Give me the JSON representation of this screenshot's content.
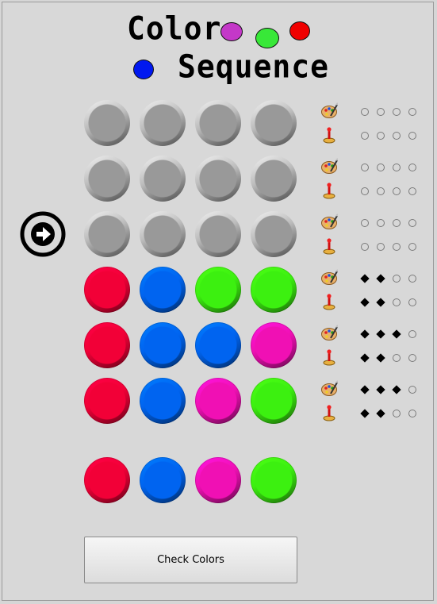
{
  "title": {
    "word1": "Color",
    "word2": "Sequence"
  },
  "colors": {
    "red": "#f20037",
    "blue": "#0064f0",
    "green": "#3cf010",
    "pink": "#f010b4",
    "empty": "#9a9a9a",
    "deco_purple": "#c438c8",
    "deco_green": "#38e838",
    "deco_red": "#f00000",
    "deco_blue": "#0018f0"
  },
  "board": {
    "rows": [
      {
        "pegs": [
          "empty",
          "empty",
          "empty",
          "empty"
        ],
        "feedback_top": [
          "o",
          "o",
          "o",
          "o"
        ],
        "feedback_bottom": [
          "o",
          "o",
          "o",
          "o"
        ]
      },
      {
        "pegs": [
          "empty",
          "empty",
          "empty",
          "empty"
        ],
        "feedback_top": [
          "o",
          "o",
          "o",
          "o"
        ],
        "feedback_bottom": [
          "o",
          "o",
          "o",
          "o"
        ]
      },
      {
        "pegs": [
          "empty",
          "empty",
          "empty",
          "empty"
        ],
        "feedback_top": [
          "o",
          "o",
          "o",
          "o"
        ],
        "feedback_bottom": [
          "o",
          "o",
          "o",
          "o"
        ],
        "current": true
      },
      {
        "pegs": [
          "red",
          "blue",
          "green",
          "green"
        ],
        "feedback_top": [
          "b",
          "b",
          "o",
          "o"
        ],
        "feedback_bottom": [
          "b",
          "b",
          "o",
          "o"
        ]
      },
      {
        "pegs": [
          "red",
          "blue",
          "blue",
          "pink"
        ],
        "feedback_top": [
          "b",
          "b",
          "b",
          "o"
        ],
        "feedback_bottom": [
          "b",
          "b",
          "o",
          "o"
        ]
      },
      {
        "pegs": [
          "red",
          "blue",
          "pink",
          "green"
        ],
        "feedback_top": [
          "b",
          "b",
          "b",
          "o"
        ],
        "feedback_bottom": [
          "b",
          "b",
          "o",
          "o"
        ]
      }
    ]
  },
  "selection": [
    "red",
    "blue",
    "pink",
    "green"
  ],
  "icons": {
    "palette": "palette-icon",
    "pin": "pin-icon",
    "arrow": "arrow-right-circle-icon"
  },
  "button": {
    "label": "Check Colors"
  }
}
